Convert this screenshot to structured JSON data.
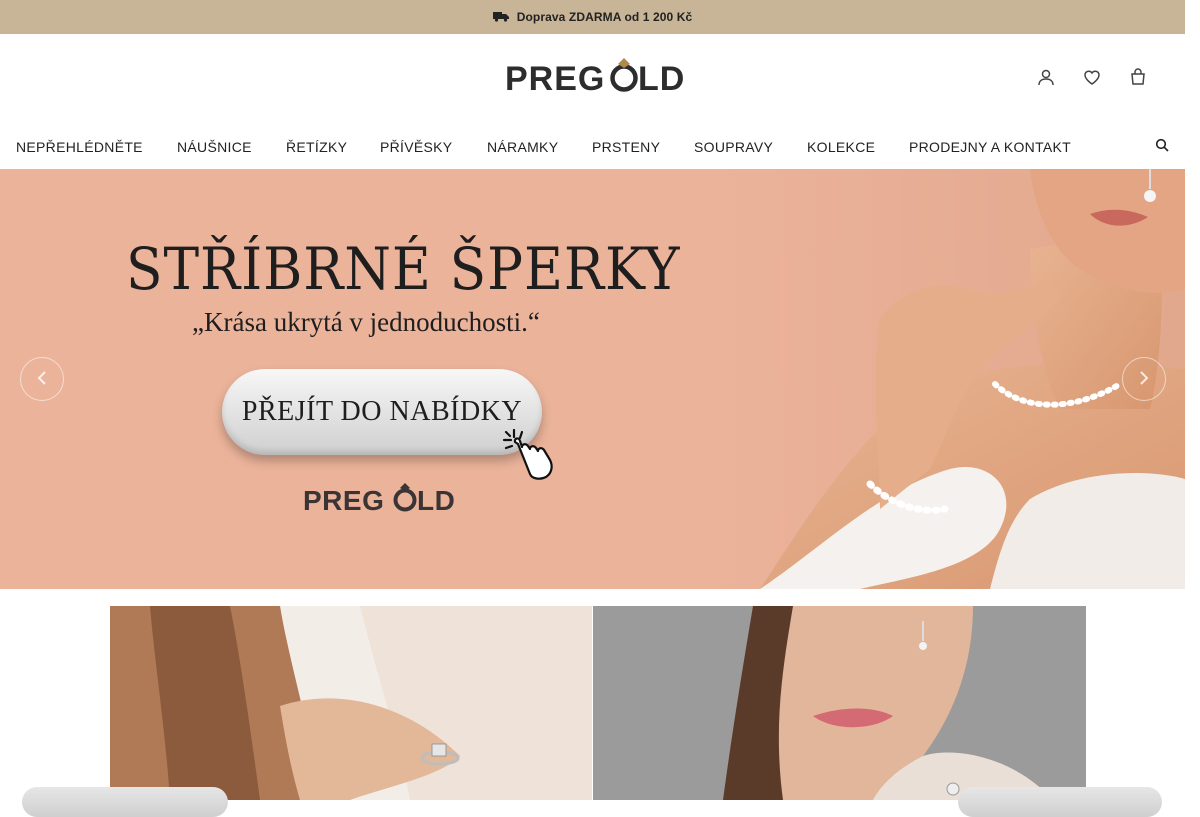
{
  "topbar": {
    "icon": "truck-icon",
    "text": "Doprava ZDARMA od 1 200 Kč"
  },
  "brand": {
    "logo_text": "PREGOLD"
  },
  "header_icons": [
    {
      "name": "user-icon"
    },
    {
      "name": "heart-icon"
    },
    {
      "name": "cart-icon"
    }
  ],
  "nav": {
    "items": [
      "NEPŘEHLÉDNĚTE",
      "NÁUŠNICE",
      "ŘETÍZKY",
      "PŘÍVĚSKY",
      "NÁRAMKY",
      "PRSTENY",
      "SOUPRAVY",
      "KOLEKCE",
      "PRODEJNY A KONTAKT"
    ],
    "search_icon": "search-icon"
  },
  "hero": {
    "title": "STŘÍBRNÉ ŠPERKY",
    "subtitle": "„Krása ukrytá v jednoduchosti.“",
    "cta_label": "PŘEJÍT DO NABÍDKY",
    "logo_text": "PREGOLD",
    "prev_icon": "chevron-left-icon",
    "next_icon": "chevron-right-icon"
  },
  "colors": {
    "topbar_bg": "#c8b496",
    "hero_bg": "#ebb39a",
    "text": "#222222"
  }
}
